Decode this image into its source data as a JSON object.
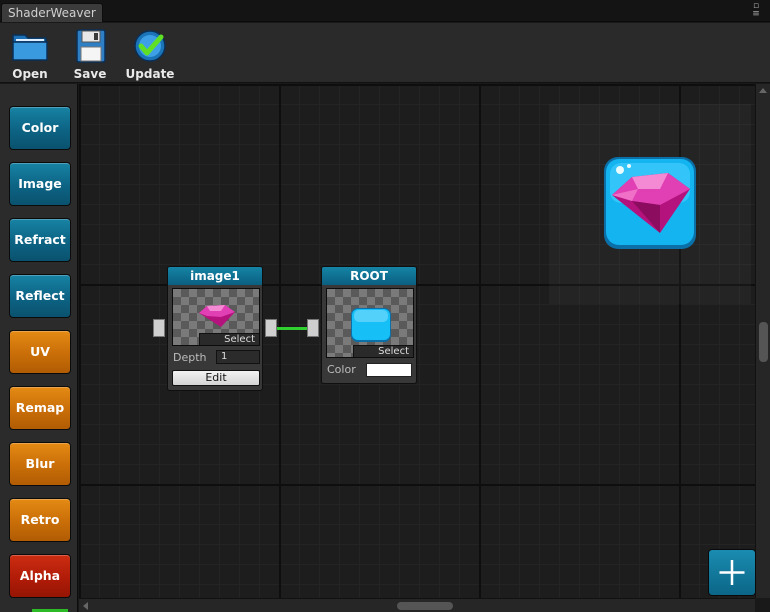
{
  "window": {
    "tab_title": "ShaderWeaver",
    "menu_icon": "window-menu-icon"
  },
  "toolbar": {
    "open_label": "Open",
    "save_label": "Save",
    "update_label": "Update"
  },
  "left_panel": {
    "buttons": [
      {
        "label": "Color",
        "color": "#0d6384"
      },
      {
        "label": "Image",
        "color": "#0d6384"
      },
      {
        "label": "Refract",
        "color": "#0d6384"
      },
      {
        "label": "Reflect",
        "color": "#0d6384"
      },
      {
        "label": "UV",
        "color": "#c96e08"
      },
      {
        "label": "Remap",
        "color": "#c96e08"
      },
      {
        "label": "Blur",
        "color": "#c96e08"
      },
      {
        "label": "Retro",
        "color": "#c96e08"
      },
      {
        "label": "Alpha",
        "color": "#b11c08"
      }
    ]
  },
  "nodes": {
    "image1": {
      "title": "image1",
      "select_label": "Select",
      "depth_label": "Depth",
      "depth_value": "1",
      "edit_label": "Edit"
    },
    "root": {
      "title": "ROOT",
      "select_label": "Select",
      "color_label": "Color",
      "color_value": "#ffffff"
    }
  },
  "connection": {
    "color": "#30d030"
  },
  "add_button": {
    "icon": "plus-icon"
  },
  "colors": {
    "accent_blue": "#0d6384",
    "accent_orange": "#c96e08",
    "accent_red": "#b11c08",
    "wire_green": "#30d030"
  }
}
